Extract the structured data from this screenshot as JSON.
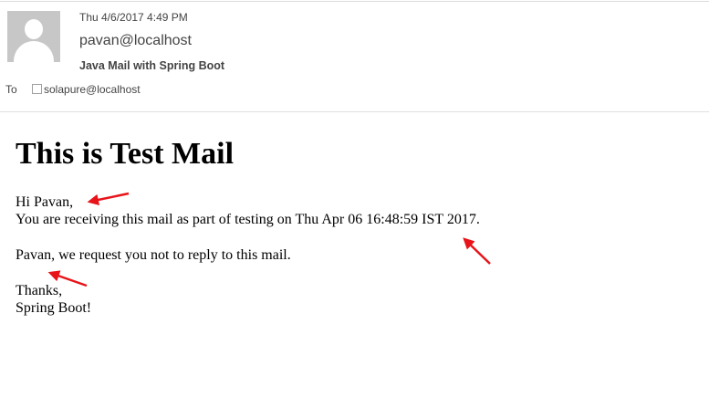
{
  "header": {
    "date": "Thu 4/6/2017 4:49 PM",
    "from": "pavan@localhost",
    "subject": "Java Mail with Spring Boot",
    "to_label": "To",
    "to_address": "solapure@localhost"
  },
  "body": {
    "heading": "This is Test Mail",
    "greeting": "Hi Pavan,",
    "line1": "You are receiving this mail as part of testing on Thu Apr 06 16:48:59 IST 2017.",
    "request": "Pavan, we request you not to reply to this mail.",
    "thanks": "Thanks,",
    "signature": "Spring Boot!"
  },
  "colors": {
    "annotation_arrow": "#e8141a",
    "avatar_bg": "#c7c7c7",
    "meta_text": "#444444"
  }
}
